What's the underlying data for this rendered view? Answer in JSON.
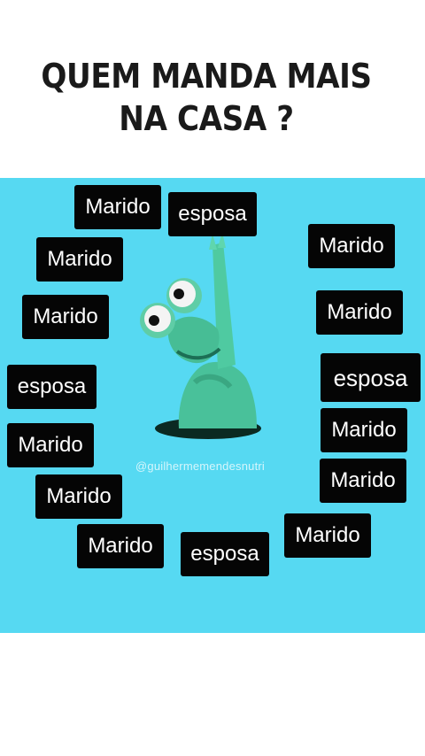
{
  "title": {
    "line1": "QUEM MANDA MAIS",
    "line2": "NA CASA ?"
  },
  "watermark": "@guilhermemendesnutri",
  "colors": {
    "panel": "#56d9f2",
    "frog": "#4bc49a",
    "label_bg": "#050505",
    "label_text": "#ffffff"
  },
  "labels": [
    {
      "id": "marido-1",
      "text": "Marido"
    },
    {
      "id": "esposa-1",
      "text": "esposa"
    },
    {
      "id": "marido-2",
      "text": "Marido"
    },
    {
      "id": "marido-3",
      "text": "Marido"
    },
    {
      "id": "marido-4",
      "text": "Marido"
    },
    {
      "id": "marido-5",
      "text": "Marido"
    },
    {
      "id": "esposa-2",
      "text": "esposa"
    },
    {
      "id": "esposa-3",
      "text": "esposa"
    },
    {
      "id": "marido-6",
      "text": "Marido"
    },
    {
      "id": "marido-7",
      "text": "Marido"
    },
    {
      "id": "marido-8",
      "text": "Marido"
    },
    {
      "id": "marido-9",
      "text": "Marido"
    },
    {
      "id": "marido-10",
      "text": "Marido"
    },
    {
      "id": "marido-11",
      "text": "Marido"
    },
    {
      "id": "esposa-4",
      "text": "esposa"
    }
  ]
}
